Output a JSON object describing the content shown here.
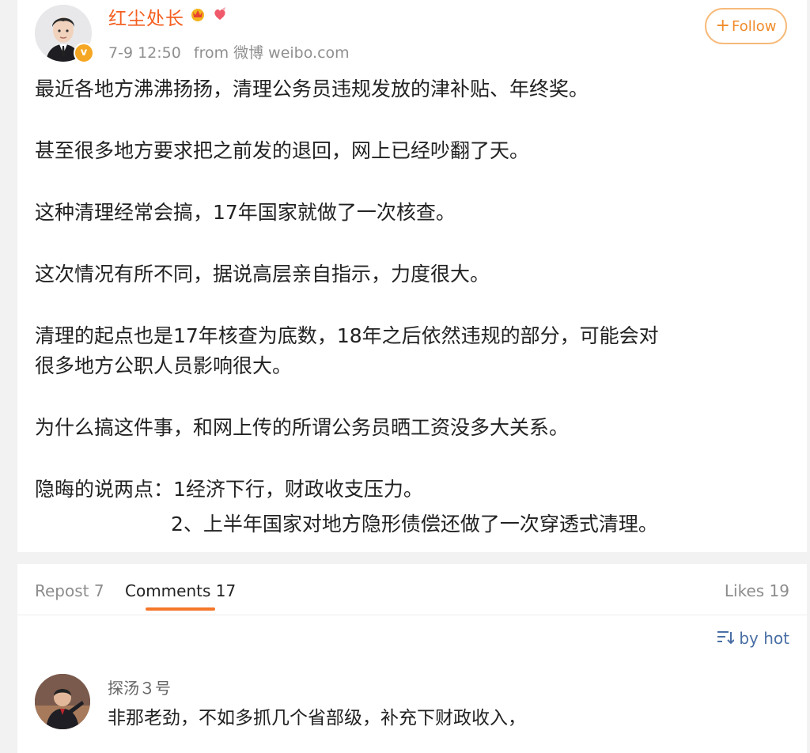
{
  "post": {
    "author": "红尘处长",
    "date": "7-9 12:50",
    "source": "from 微博 weibo.com",
    "follow_label": "Follow",
    "verified_mark": "v",
    "paragraphs": [
      "最近各地方沸沸扬扬，清理公务员违规发放的津补贴、年终奖。",
      "甚至很多地方要求把之前发的退回，网上已经吵翻了天。",
      "这种清理经常会搞，17年国家就做了一次核查。",
      "这次情况有所不同，据说高层亲自指示，力度很大。",
      "清理的起点也是17年核查为底数，18年之后依然违规的部分，可能会对",
      "很多地方公职人员影响很大。",
      "为什么搞这件事，和网上传的所谓公务员晒工资没多大关系。",
      "隐晦的说两点：1经济下行，财政收支压力。",
      "2、上半年国家对地方隐形债偿还做了一次穿透式清理。"
    ]
  },
  "tabs": {
    "repost": "Repost 7",
    "comments": "Comments 17",
    "likes": "Likes 19"
  },
  "sort_label": "by hot",
  "comment": {
    "user": "探汤３号",
    "text": "非那老劲，不如多抓几个省部级，补充下财政收入，"
  },
  "colors": {
    "author": "#f45e1f",
    "accent": "#f5772a",
    "link": "#4a6fa5",
    "follow_border": "#f7ba7a",
    "verified": "#f5a623"
  },
  "icons": [
    "avatar",
    "verified-badge-icon",
    "crown-badge-icon",
    "heart-badge-icon",
    "plus-icon",
    "sort-icon"
  ]
}
